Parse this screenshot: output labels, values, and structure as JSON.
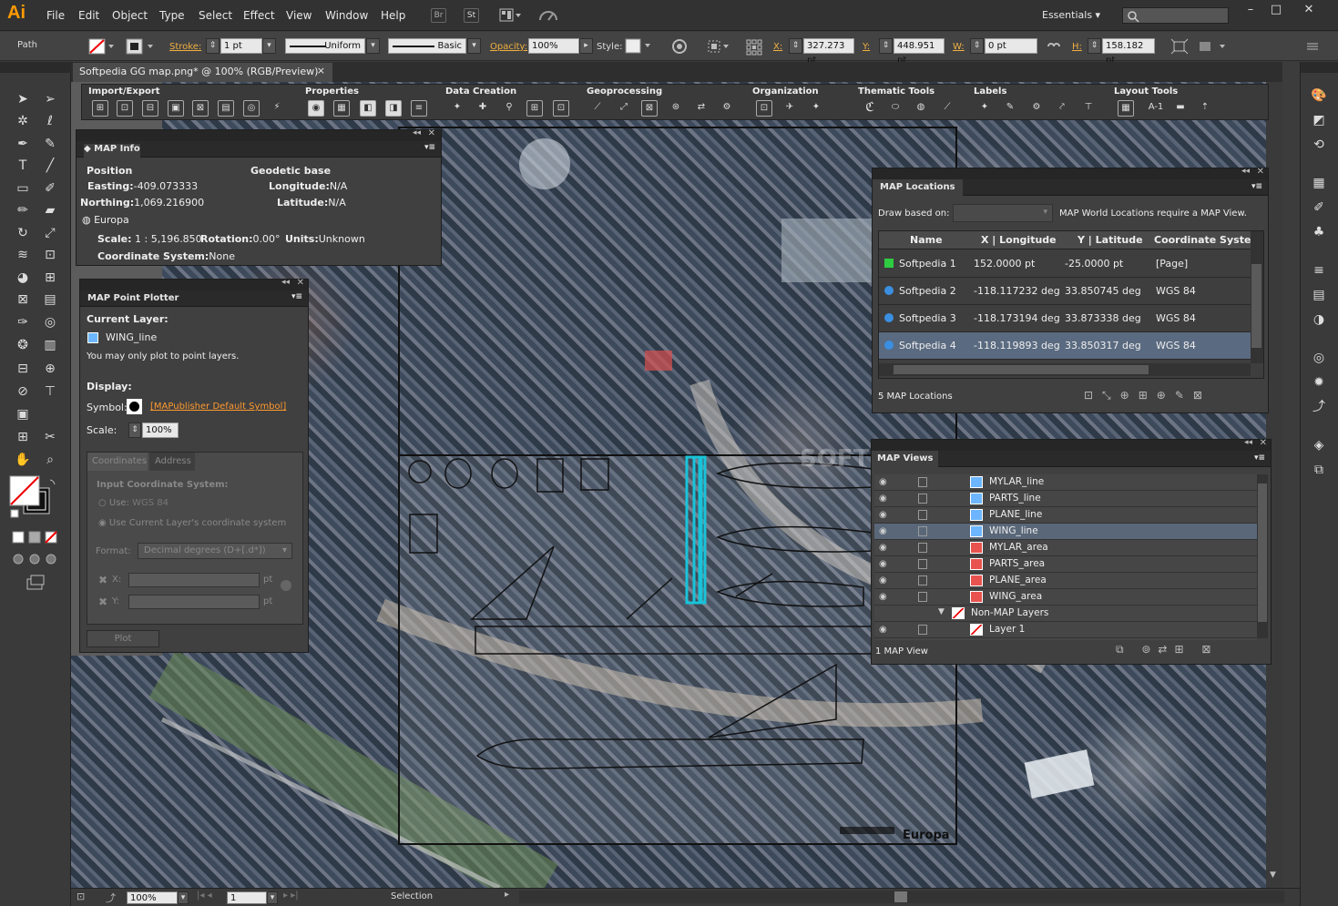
{
  "app": {
    "logo": "Ai"
  },
  "menu": [
    "File",
    "Edit",
    "Object",
    "Type",
    "Select",
    "Effect",
    "View",
    "Window",
    "Help"
  ],
  "menu_icons": {
    "bridge": "Br",
    "stock": "St"
  },
  "workspace": "Essentials",
  "window_controls": {
    "minimize": "–",
    "maximize": "□",
    "close": "✕"
  },
  "control_bar": {
    "selection_type": "Path",
    "stroke_label": "Stroke:",
    "stroke_weight": "1 pt",
    "profile_uniform": "Uniform",
    "brush_basic": "Basic",
    "opacity_label": "Opacity:",
    "opacity_value": "100%",
    "style_label": "Style:",
    "x_label": "X:",
    "x_value": "327.273 pt",
    "y_label": "Y:",
    "y_value": "448.951 pt",
    "w_label": "W:",
    "w_value": "0 pt",
    "h_label": "H:",
    "h_value": "158.182 pt"
  },
  "document_tab": {
    "title": "Softpedia GG map.png* @ 100% (RGB/Preview)",
    "close": "×"
  },
  "toolset": {
    "groups": [
      "Import/Export",
      "Properties",
      "Data Creation",
      "Geoprocessing",
      "Organization",
      "Thematic Tools",
      "Labels",
      "Layout Tools"
    ],
    "layout_text": "A-1"
  },
  "map_info": {
    "title": "MAP Info",
    "position_label": "Position",
    "easting_label": "Easting:",
    "easting_value": "-409.073333",
    "northing_label": "Northing:",
    "northing_value": "1,069.216900",
    "geodetic_label": "Geodetic base",
    "longitude_label": "Longitude:",
    "longitude_value": "N/A",
    "latitude_label": "Latitude:",
    "latitude_value": "N/A",
    "region": "Europa",
    "scale_label": "Scale:",
    "scale_value": "1 : 5,196.850",
    "rotation_label": "Rotation:",
    "rotation_value": "0.00°",
    "units_label": "Units:",
    "units_value": "Unknown",
    "coord_sys_label": "Coordinate System:",
    "coord_sys_value": "None"
  },
  "point_plotter": {
    "title": "MAP Point Plotter",
    "current_layer_label": "Current Layer:",
    "current_layer_value": "WING_line",
    "note": "You may only plot to point layers.",
    "display_label": "Display:",
    "symbol_label": "Symbol:",
    "symbol_value": "[MAPublisher Default Symbol]",
    "scale_label": "Scale:",
    "scale_value": "100%",
    "tab_coordinates": "Coordinates",
    "tab_address": "Address",
    "input_cs_label": "Input Coordinate System:",
    "use_label": "Use:",
    "use_value": "WGS 84",
    "use_current": "Use Current Layer's coordinate system",
    "format_label": "Format:",
    "format_value": "Decimal degrees (D+[.d*])",
    "x_label": "X:",
    "y_label": "Y:",
    "unit": "pt",
    "plot_button": "Plot"
  },
  "map_locations": {
    "title": "MAP Locations",
    "draw_label": "Draw based on:",
    "message": "MAP World Locations require a MAP View.",
    "columns": [
      "Name",
      "X | Longitude",
      "Y | Latitude",
      "Coordinate System"
    ],
    "rows": [
      {
        "name": "Softpedia 1",
        "x": "152.0000 pt",
        "y": "-25.0000 pt",
        "cs": "[Page]",
        "color": "#2ecc40"
      },
      {
        "name": "Softpedia 2",
        "x": "-118.117232 deg",
        "y": "33.850745 deg",
        "cs": "WGS 84",
        "color": "#3b8fe0"
      },
      {
        "name": "Softpedia 3",
        "x": "-118.173194 deg",
        "y": "33.873338 deg",
        "cs": "WGS 84",
        "color": "#3b8fe0"
      },
      {
        "name": "Softpedia 4",
        "x": "-118.119893 deg",
        "y": "33.850317 deg",
        "cs": "WGS 84",
        "color": "#3b8fe0"
      }
    ],
    "footer": "5 MAP Locations"
  },
  "map_views": {
    "title": "MAP Views",
    "layers": [
      {
        "name": "MYLAR_line",
        "kind": "line"
      },
      {
        "name": "PARTS_line",
        "kind": "line"
      },
      {
        "name": "PLANE_line",
        "kind": "line"
      },
      {
        "name": "WING_line",
        "kind": "line"
      },
      {
        "name": "MYLAR_area",
        "kind": "area"
      },
      {
        "name": "PARTS_area",
        "kind": "area"
      },
      {
        "name": "PLANE_area",
        "kind": "area"
      },
      {
        "name": "WING_area",
        "kind": "area"
      },
      {
        "name": "Non-MAP Layers",
        "kind": "group"
      },
      {
        "name": "Layer 1",
        "kind": "plain"
      }
    ],
    "footer": "1 MAP View"
  },
  "canvas": {
    "watermark": "SOFTPEDIA",
    "europa_label": "Europa"
  },
  "status_bar": {
    "zoom": "100%",
    "artboard": "1",
    "tool": "Selection"
  }
}
